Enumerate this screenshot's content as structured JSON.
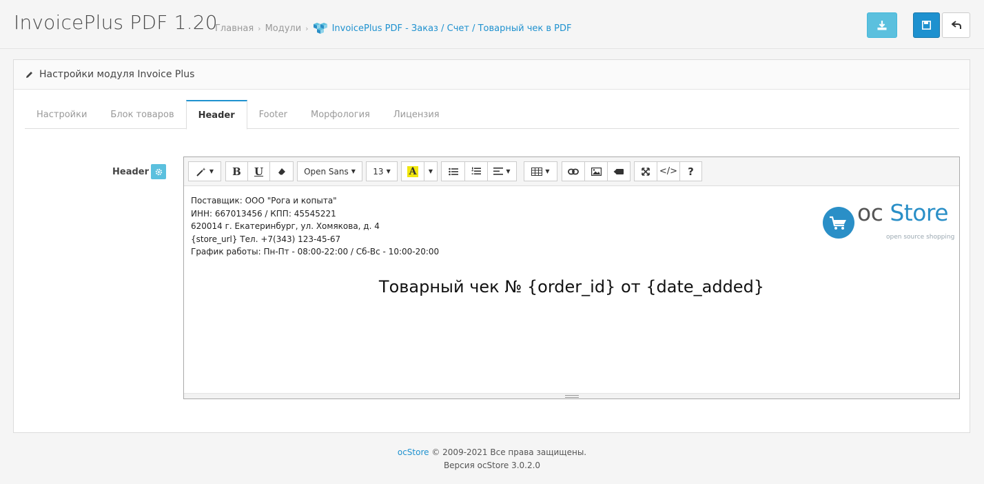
{
  "header": {
    "title": "InvoicePlus PDF 1.20",
    "breadcrumb": {
      "home": "Главная",
      "modules": "Модули",
      "current": "InvoicePlus PDF - Заказ / Счет / Товарный чек в PDF"
    }
  },
  "panel": {
    "title": "Настройки модуля Invoice Plus",
    "tabs": [
      {
        "label": "Настройки",
        "active": false
      },
      {
        "label": "Блок товаров",
        "active": false
      },
      {
        "label": "Header",
        "active": true
      },
      {
        "label": "Footer",
        "active": false
      },
      {
        "label": "Морфология",
        "active": false
      },
      {
        "label": "Лицензия",
        "active": false
      }
    ],
    "field_label": "Header"
  },
  "editor": {
    "toolbar": {
      "font_name": "Open Sans",
      "font_size": "13"
    },
    "content": {
      "lines": [
        "Поставщик: ООО \"Рога и копыта\"",
        "ИНН: 667013456 / КПП: 45545221",
        "620014 г. Екатеринбург, ул. Хомякова, д. 4",
        "{store_url} Тел. +7(343) 123-45-67",
        "График работы: Пн-Пт - 08:00-22:00 / Сб-Вс - 10:00-20:00"
      ],
      "receipt_title": "Товарный чек № {order_id} от {date_added}",
      "logo_oc": "oc",
      "logo_store": "Store",
      "logo_tagline": "open source shopping"
    }
  },
  "footer": {
    "brand": "ocStore",
    "copyright": "© 2009-2021 Все права защищены.",
    "version": "Версия ocStore 3.0.2.0"
  },
  "colors": {
    "accent": "#1e91cf",
    "info": "#5bc0de",
    "highlight": "#f1e70f"
  }
}
